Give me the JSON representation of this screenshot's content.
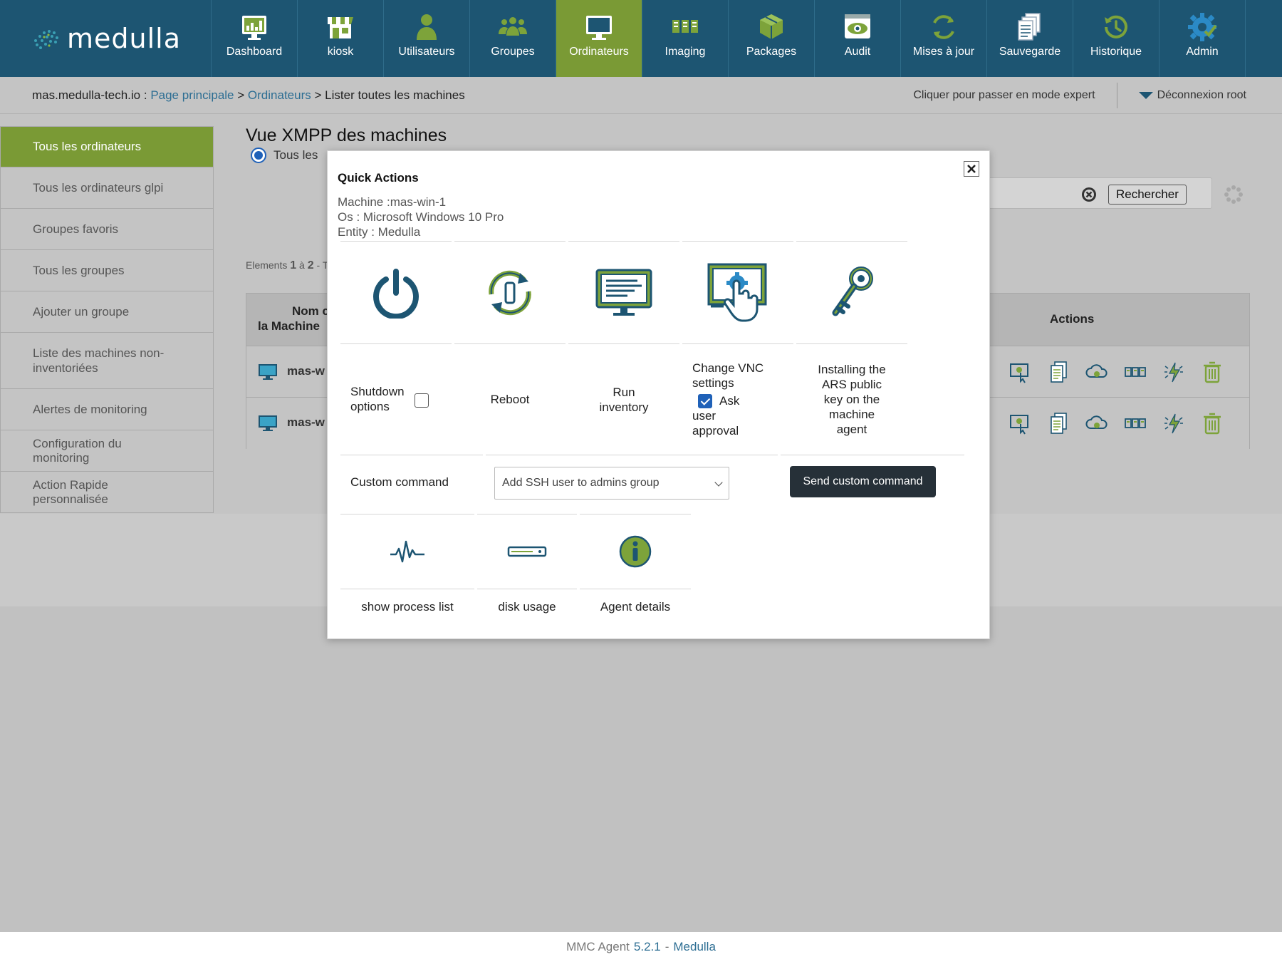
{
  "app": {
    "logo_text": "medulla"
  },
  "nav": {
    "items": [
      {
        "label": "Dashboard",
        "icon": "dashboard-icon"
      },
      {
        "label": "kiosk",
        "icon": "kiosk-icon"
      },
      {
        "label": "Utilisateurs",
        "icon": "user-icon"
      },
      {
        "label": "Groupes",
        "icon": "group-icon"
      },
      {
        "label": "Ordinateurs",
        "icon": "monitor-icon",
        "active": true
      },
      {
        "label": "Imaging",
        "icon": "imaging-icon"
      },
      {
        "label": "Packages",
        "icon": "packages-icon"
      },
      {
        "label": "Audit",
        "icon": "audit-eye-icon"
      },
      {
        "label": "Mises à jour",
        "icon": "update-icon"
      },
      {
        "label": "Sauvegarde",
        "icon": "backup-icon"
      },
      {
        "label": "Historique",
        "icon": "history-icon"
      },
      {
        "label": "Admin",
        "icon": "admin-gear-icon"
      }
    ]
  },
  "breadcrumb": {
    "host": "mas.medulla-tech.io :",
    "home": "Page principale",
    "sep": ">",
    "section": "Ordinateurs",
    "current": "Lister toutes les machines",
    "expert_mode": "Cliquer pour passer en mode expert",
    "logout": "Déconnexion root"
  },
  "sidebar": {
    "items": [
      {
        "label": "Tous les ordinateurs",
        "active": true
      },
      {
        "label": "Tous les ordinateurs glpi"
      },
      {
        "label": "Groupes favoris"
      },
      {
        "label": "Tous les groupes"
      },
      {
        "label": "Ajouter un groupe"
      },
      {
        "label": "Liste des machines non-inventoriées"
      },
      {
        "label": "Alertes de monitoring"
      },
      {
        "label": "Configuration du monitoring"
      },
      {
        "label": "Action Rapide personnalisée"
      }
    ]
  },
  "main": {
    "title": "Vue XMPP des machines",
    "radio_label": "Tous les",
    "search_button": "Rechercher",
    "elements_prefix": "Elements",
    "elements_from": "1",
    "elements_mid": "à",
    "elements_to": "2",
    "elements_suffix": "- T",
    "table": {
      "col_name_line1": "Nom c",
      "col_name_line2": "la Machine",
      "col_actions": "Actions",
      "rows": [
        {
          "name": "mas-w"
        },
        {
          "name": "mas-w"
        }
      ]
    }
  },
  "modal": {
    "title": "Quick Actions",
    "machine": "Machine :mas-win-1",
    "os": "Os : Microsoft Windows 10 Pro",
    "entity": "Entity : Medulla",
    "actions": {
      "shutdown_label": "Shutdown options",
      "reboot_label": "Reboot",
      "inventory_label": "Run inventory",
      "vnc_label": "Change VNC settings",
      "vnc_ask": "Ask",
      "vnc_approval": "user approval",
      "vnc_ask_checked": true,
      "ars_label": "Installing the ARS public key on the machine agent"
    },
    "custom": {
      "label": "Custom command",
      "selected": "Add SSH user to admins group",
      "send_button": "Send custom command"
    },
    "extra": {
      "process_label": "show process list",
      "disk_label": "disk usage",
      "agent_label": "Agent details"
    }
  },
  "footer": {
    "product": "MMC Agent",
    "version": "5.2.1",
    "sep": "-",
    "brand": "Medulla"
  },
  "colors": {
    "nav_bg": "#1d5572",
    "accent_green": "#7a9a35",
    "icon_blue": "#1d5572",
    "icon_green": "#7da33a",
    "button_dark": "#263038"
  }
}
